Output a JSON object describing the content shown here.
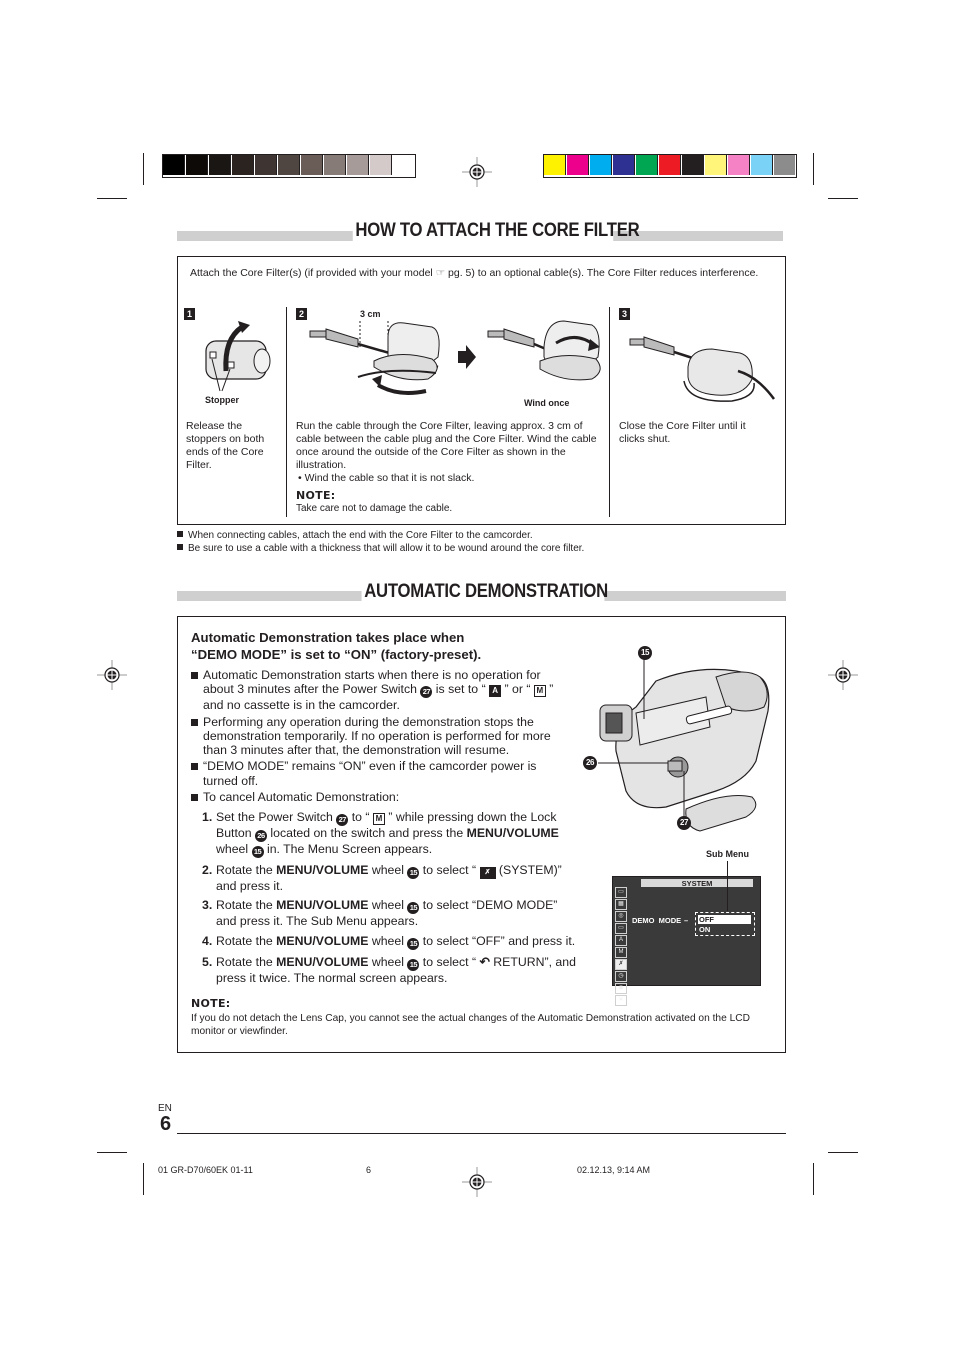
{
  "color_bars": {
    "grayscale": [
      "#000000",
      "#0d0a08",
      "#1a1614",
      "#2a2320",
      "#3e3431",
      "#4f4541",
      "#6a5d58",
      "#877b77",
      "#a69b98",
      "#d4caca",
      "#ffffff"
    ],
    "process": [
      "#fff200",
      "#ec008c",
      "#00aeef",
      "#2e3192",
      "#00a651",
      "#ed1c24",
      "#231f20",
      "#fff57a",
      "#f582c5",
      "#7ad3f7",
      "#8c8c8c"
    ]
  },
  "section1": {
    "title": "HOW TO ATTACH THE CORE FILTER",
    "intro_prefix": "Attach the Core Filter(s) (if provided with your model ",
    "intro_ref_icon": "☞",
    "intro_suffix": " pg. 5) to an optional cable(s). The Core Filter reduces interference.",
    "steps": [
      {
        "number": "1",
        "illustration_labels": [
          "Stopper"
        ],
        "text": "Release the stoppers on both ends of the Core Filter."
      },
      {
        "number": "2",
        "illustration_labels": [
          "3 cm",
          "Wind once"
        ],
        "text": "Run the cable through the Core Filter, leaving approx. 3 cm of cable between the cable plug and the Core Filter. Wind the cable once around the outside of the Core Filter as shown in the illustration.",
        "bullet": "• Wind the cable so that it is not slack.",
        "note_heading": "NOTE:",
        "note_text": "Take care not to damage the cable."
      },
      {
        "number": "3",
        "illustration_labels": [],
        "text": "Close the Core Filter until it clicks shut."
      }
    ],
    "notes": [
      "When connecting cables, attach the end with the Core Filter to the camcorder.",
      "Be sure to use a cable with a thickness that will allow it to be wound around the core filter."
    ]
  },
  "section2": {
    "title": "AUTOMATIC DEMONSTRATION",
    "heading_line1": "Automatic Demonstration takes place when",
    "heading_line2": "“DEMO MODE” is set to “ON” (factory-preset).",
    "bullets": {
      "b1_a": "Automatic Demonstration starts when there is no operation for about 3 minutes after the Power Switch ",
      "b1_ref": "27",
      "b1_b": " is set to “ ",
      "b1_icon_a": "A",
      "b1_c": " ” or “ ",
      "b1_icon_m": "M",
      "b1_d": " ” and no cassette is in the camcorder.",
      "b2": "Performing any operation during the demonstration stops the demonstration temporarily. If no operation is performed for more than 3 minutes after that, the demonstration will resume.",
      "b3": "“DEMO MODE” remains “ON” even if the camcorder power is turned off.",
      "b4": "To cancel Automatic Demonstration:"
    },
    "steps": {
      "s1_num": "1.",
      "s1_a": "Set the Power Switch ",
      "s1_ref1": "27",
      "s1_b": " to “ ",
      "s1_icon": "M",
      "s1_c": " ” while pressing down the Lock Button ",
      "s1_ref2": "26",
      "s1_d": " located on the switch and press the ",
      "s1_bold": "MENU/VOLUME",
      "s1_e": " wheel ",
      "s1_ref3": "15",
      "s1_f": " in. The Menu Screen appears.",
      "s2_num": "2.",
      "s2_a": "Rotate the ",
      "s2_bold": "MENU/VOLUME",
      "s2_b": " wheel ",
      "s2_ref": "15",
      "s2_c": " to select “ ",
      "s2_icon": "system-icon",
      "s2_d": " (SYSTEM)” and press it.",
      "s3_num": "3.",
      "s3_a": "Rotate the ",
      "s3_bold": "MENU/VOLUME",
      "s3_b": " wheel ",
      "s3_ref": "15",
      "s3_c": " to select “DEMO MODE” and press it. The Sub Menu appears.",
      "s4_num": "4.",
      "s4_a": "Rotate the ",
      "s4_bold": "MENU/VOLUME",
      "s4_b": " wheel ",
      "s4_ref": "15",
      "s4_c": " to select “OFF” and press it.",
      "s5_num": "5.",
      "s5_a": "Rotate the ",
      "s5_bold": "MENU/VOLUME",
      "s5_b": " wheel ",
      "s5_ref": "15",
      "s5_c": " to select “ ",
      "s5_icon": "↶",
      "s5_d": " RETURN”, and press it twice. The normal screen appears."
    },
    "camcorder_callouts": [
      "15",
      "26",
      "27"
    ],
    "menu_screen": {
      "sub_menu_label": "Sub Menu",
      "title": "SYSTEM",
      "item": "DEMO  MODE",
      "options": [
        "OFF",
        "ON"
      ],
      "selected": "OFF"
    },
    "note_heading": "NOTE:",
    "note_text": "If you do not detach the Lens Cap, you cannot see the actual changes of the Automatic Demonstration activated on the LCD monitor or viewfinder."
  },
  "footer": {
    "lang": "EN",
    "page_number": "6",
    "slug_file": "01 GR-D70/60EK 01-11",
    "slug_page": "6",
    "slug_date": "02.12.13, 9:14 AM"
  }
}
